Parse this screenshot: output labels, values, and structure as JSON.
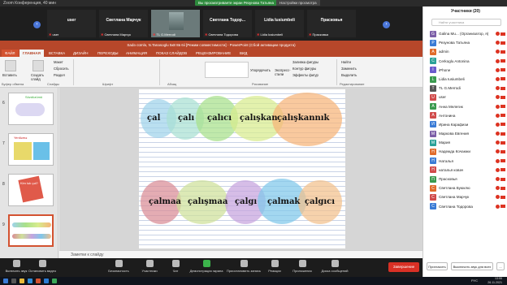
{
  "zoom": {
    "window_title": "Zoom Конференция, 40 мин",
    "share_banner": "Вы просматриваете экран Резунова Татьяна",
    "view_options": "Настройки просмотра"
  },
  "strip": {
    "tiles": [
      {
        "name": "user",
        "label": "user"
      },
      {
        "name": "Светлана Марчук",
        "label": "Светлана Марчук"
      },
      {
        "name": "",
        "label": "TL G.Merrodi"
      },
      {
        "name": "Светлана Тодор...",
        "label": "Светлана Тодорова"
      },
      {
        "name": "Lidia Iusiumbeli",
        "label": "Lidia Iusiumbeli"
      },
      {
        "name": "Прасковья",
        "label": "Прасковья"
      }
    ]
  },
  "ppt": {
    "title": "Sadə cümlə, N.Tanasoglu 5к8 8в 6ii [Режим совместимости] - PowerPoint (Сбой активации продукта)",
    "tabs": [
      "ФАЙЛ",
      "ГЛАВНАЯ",
      "ВСТАВКА",
      "ДИЗАЙН",
      "ПЕРЕХОДЫ",
      "АНИМАЦИЯ",
      "ПОКАЗ СЛАЙДОВ",
      "РЕЦЕНЗИРОВАНИЕ",
      "ВИД"
    ],
    "ribbon": {
      "paste": "Вставить",
      "create_slide": "Создать слайд",
      "layout": "Макет",
      "reset": "Сбросить",
      "section": "Раздел",
      "find": "Найти",
      "replace": "Заменить",
      "select": "Выделить",
      "arrange": "Упорядочить",
      "quick_styles": "Экспресс-стили",
      "fill": "Заливка фигуры",
      "outline": "Контур фигуры",
      "effects": "Эффекты фигур",
      "groups": [
        "Буфер обмена",
        "Слайды",
        "Шрифт",
        "Абзац",
        "Рисование",
        "Редактирование"
      ]
    },
    "slide_numbers": [
      "6",
      "7",
      "8",
      "9"
    ],
    "thumb_texts": [
      "Sözdüzümü",
      "Yeniləmə",
      "Kim tək çəl?",
      ""
    ],
    "notes_placeholder": "Заметки к слайду"
  },
  "slide": {
    "row1": [
      "çal",
      "çalı",
      "çalıcı",
      "çalışkan",
      "çalışkannık"
    ],
    "row2": [
      "çalmaa",
      "çalışmaa",
      "çalgı",
      "çalmak",
      "çalgıcı"
    ],
    "colors": {
      "blue": "#9fd3ea",
      "teal": "#a9e0d2",
      "green": "#a8e08a",
      "lime": "#d8ec8e",
      "orange": "#f6b478",
      "red": "#d98c95",
      "olive": "#cfe09a",
      "purple": "#c6a4de",
      "sky": "#7fc7ea",
      "peach": "#f3c08c"
    }
  },
  "toolbar": {
    "items": [
      "Включить звук",
      "Остановить видео",
      "Безопасность",
      "Участники",
      "Чат",
      "Демонстрация экрана",
      "Приостановить запись",
      "Реакции",
      "Приложения",
      "Доска сообщений"
    ],
    "participants_count": "20",
    "end": "Завершение"
  },
  "taskbar": {
    "time": "13:55",
    "date": "26.11.2021",
    "lang": "РУС"
  },
  "panel": {
    "title": "Участники (20)",
    "search_placeholder": "Найти участника",
    "participants": [
      {
        "initial": "G",
        "name": "Galina Mu... (Организатор, я)",
        "color": "#7b5ea7"
      },
      {
        "initial": "Р",
        "name": "Резунова Татьяна",
        "color": "#3a7bd5"
      },
      {
        "initial": "A",
        "name": "admin",
        "color": "#e06b2b"
      },
      {
        "initial": "C",
        "name": "Cerkoglu Antonina",
        "color": "#2aa198"
      },
      {
        "initial": "I",
        "name": "iPhone",
        "color": "#6a5acd"
      },
      {
        "initial": "L",
        "name": "Lidia Iusiumbeli",
        "color": "#3a9a4f"
      },
      {
        "initial": "T",
        "name": "TL G.Merrodi",
        "color": "#555555"
      },
      {
        "initial": "U",
        "name": "user",
        "color": "#d04a4a"
      },
      {
        "initial": "А",
        "name": "Анна Мелегик",
        "color": "#3a9a4f"
      },
      {
        "initial": "А",
        "name": "Антонина",
        "color": "#d04a4a"
      },
      {
        "initial": "И",
        "name": "Ирина Карафизи",
        "color": "#3a7bd5"
      },
      {
        "initial": "М",
        "name": "Маркова Евгения",
        "color": "#7b5ea7"
      },
      {
        "initial": "М",
        "name": "Мария",
        "color": "#2aa198"
      },
      {
        "initial": "Н",
        "name": "Надежда Кочанжи",
        "color": "#e06b2b"
      },
      {
        "initial": "Н",
        "name": "Наталья",
        "color": "#3a7bd5"
      },
      {
        "initial": "Н",
        "name": "наталья ковач",
        "color": "#d04a4a"
      },
      {
        "initial": "П",
        "name": "Прасковья",
        "color": "#3a9a4f"
      },
      {
        "initial": "С",
        "name": "Светлана Буюклю",
        "color": "#e06b2b"
      },
      {
        "initial": "С",
        "name": "Светлана Марчук",
        "color": "#d04a4a"
      },
      {
        "initial": "С",
        "name": "Светлана Тодорова",
        "color": "#3a7bd5"
      }
    ],
    "invite": "Пригласить",
    "mute_all": "Выключить звук для всех",
    "more": "..."
  }
}
